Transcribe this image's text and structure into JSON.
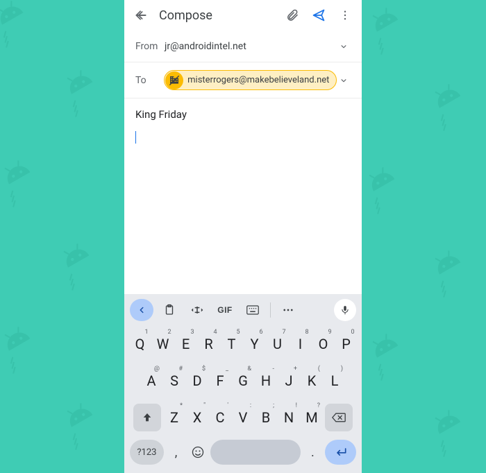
{
  "appbar": {
    "title": "Compose"
  },
  "from": {
    "label": "From",
    "value": "jr@androidintel.net"
  },
  "to": {
    "label": "To",
    "chip_email": "misterrogers@makebelieveland.net"
  },
  "subject": "King Friday",
  "body": "",
  "keyboard": {
    "toolbar": {
      "gif_label": "GIF"
    },
    "row1": [
      {
        "k": "Q",
        "h": "1"
      },
      {
        "k": "W",
        "h": "2"
      },
      {
        "k": "E",
        "h": "3"
      },
      {
        "k": "R",
        "h": "4"
      },
      {
        "k": "T",
        "h": "5"
      },
      {
        "k": "Y",
        "h": "6"
      },
      {
        "k": "U",
        "h": "7"
      },
      {
        "k": "I",
        "h": "8"
      },
      {
        "k": "O",
        "h": "9"
      },
      {
        "k": "P",
        "h": "0"
      }
    ],
    "row2": [
      {
        "k": "A",
        "h": "@"
      },
      {
        "k": "S",
        "h": "#"
      },
      {
        "k": "D",
        "h": "$"
      },
      {
        "k": "F",
        "h": "_"
      },
      {
        "k": "G",
        "h": "&"
      },
      {
        "k": "H",
        "h": "-"
      },
      {
        "k": "J",
        "h": "+"
      },
      {
        "k": "K",
        "h": "("
      },
      {
        "k": "L",
        "h": ")"
      }
    ],
    "row3": [
      {
        "k": "Z",
        "h": "*"
      },
      {
        "k": "X",
        "h": "\""
      },
      {
        "k": "C",
        "h": "'"
      },
      {
        "k": "V",
        "h": ":"
      },
      {
        "k": "B",
        "h": ";"
      },
      {
        "k": "N",
        "h": "!"
      },
      {
        "k": "M",
        "h": "?"
      }
    ],
    "bottom": {
      "symbols_label": "?123",
      "comma": ",",
      "period": "."
    }
  }
}
